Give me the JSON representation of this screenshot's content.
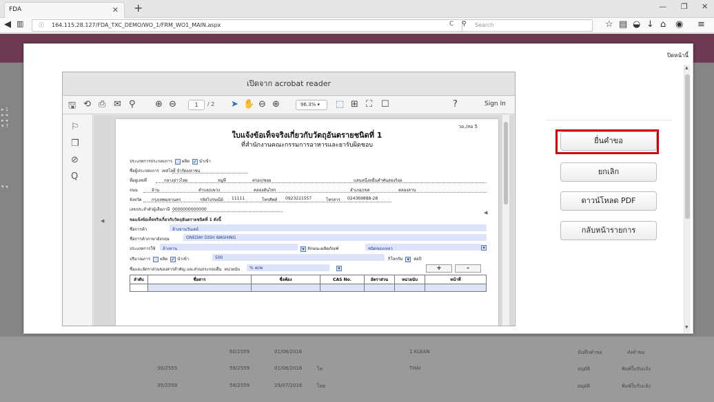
{
  "browser": {
    "tab_title": "FDA",
    "url": "164.115.28.127/FDA_TXC_DEMO/WO_1/FRM_WO1_MAIN.aspx",
    "search_placeholder": "Search"
  },
  "modal": {
    "close_link": "ปิดหน้านี้"
  },
  "acrobat": {
    "title": "เปิดจาก acrobat reader",
    "page_current": "1",
    "page_total": "/ 2",
    "zoom": "96.3%",
    "sign_in": "Sign In"
  },
  "pdf": {
    "form_code": "วอ./สอ 5",
    "title": "ใบแจ้งข้อเท็จจริงเกี่ยวกับวัตถุอันตรายชนิดที่ 1",
    "subtitle": "ที่สำนักงานคณะกรรมการอาหารและยารับผิดชอบ",
    "business_type_label": "ประเภทการประกอบการ",
    "opt_produce": "ผลิต",
    "opt_import": "นำเข้า",
    "operator_label": "ชื่อผู้ประกอบการ",
    "operator_value": "เทสโลยี่ จำกัดมหาชน",
    "address_label": "ที่อยู่เลขที่",
    "address_value": "กลางอ่าวไทย",
    "moo_label": "หมู่ที่",
    "soi_label": "ตรอก/ซอย",
    "soi_value": "แสนหนึ่งหมื่นคำพันสองร้อย",
    "road_label": "ถนน",
    "road_value": "ล้าน",
    "subdistrict_label": "ตำบล/แขวง",
    "subdistrict_value": "คลองตันไทร",
    "district_label": "อำเภอ/เขต",
    "district_value": "คลองสาน",
    "province_label": "จังหวัด",
    "province_value": "กรุงเทพมหานคร",
    "postcode_label": "รหัสไปรษณีย์",
    "postcode_value": "11111",
    "phone_label": "โทรศัพท์",
    "phone_value": "0923221557",
    "fax_label": "โทรสาร",
    "fax_value": "024369888-28",
    "taxid_label": "เลขประจำตัวผู้เสียภาษี",
    "taxid_value": "0000000000000",
    "section_heading": "ขอแจ้งข้อเท็จจริงเกี่ยวกับวัตถุอันตรายชนิดที่ 1 ดังนี้",
    "trade_name_label": "ชื่อการค้า",
    "trade_name_value": "ล้างจานวันเดย์",
    "english_name_label": "ชื่อการค้าภาษาอังกฤษ",
    "english_name_value": "ONEDAY DISH WASHING",
    "usage_label": "ประเภทการใช้",
    "usage_value": "ล้างจาน",
    "product_char_label": "ลักษณะผลิตภัณฑ์",
    "product_char_value": "ชนิดของเหลว",
    "quantity_label": "ปริมาณการ",
    "quantity_value": "500",
    "unit_value": "กิโลกรัม",
    "per_label": "ต่อปี",
    "composition_label": "ชื่อและอัตราส่วนของสารสำคัญ และส่วนประกอบอื่น",
    "unit_label": "หน่วยนับ",
    "unit_select_value": "% w/w",
    "add_row": "+",
    "remove_row": "-",
    "table_headers": [
      "ลำดับ",
      "ชื่อสาร",
      "ชื่อพ้อง",
      "CAS No.",
      "อัตราส่วน",
      "หน่วยนับ",
      "หน้าที่"
    ]
  },
  "actions": {
    "submit": "ยื่นคำขอ",
    "cancel": "ยกเลิก",
    "download_pdf": "ดาวน์โหลด PDF",
    "back_to_list": "กลับหน้ารายการ"
  },
  "background_rows": [
    [
      "60/2559",
      "01/08/2016",
      "",
      "1 KLEAN",
      "บันทึกคำขอ",
      "ส่งคำขอ"
    ],
    [
      "30/2559",
      "59/2559",
      "01/08/2016",
      "ไท",
      "THAI",
      "อนุมัติ",
      "พิมพ์ใบรับแจ้ง"
    ],
    [
      "35/2559",
      "58/2559",
      "29/07/2016",
      "ไทย",
      "",
      "อนุมัติ",
      "พิมพ์ใบรับแจ้ง"
    ]
  ]
}
